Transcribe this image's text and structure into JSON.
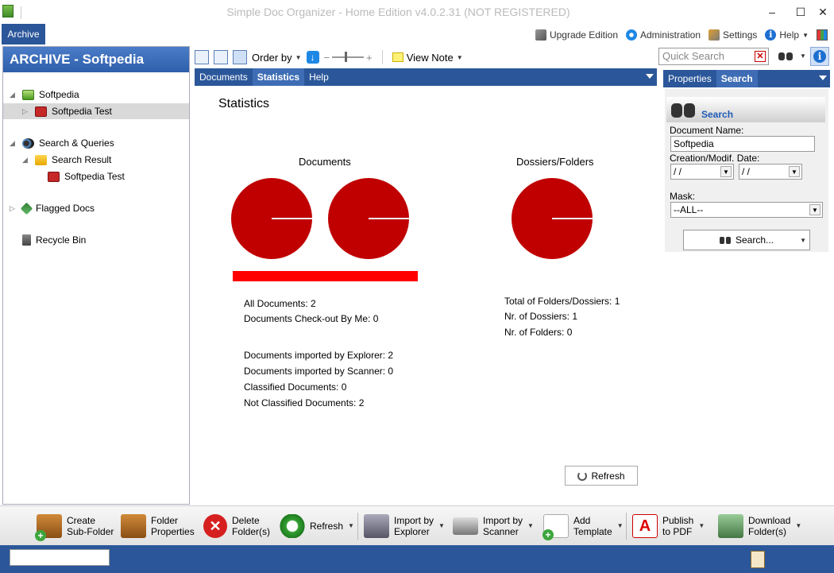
{
  "window": {
    "title": "Simple Doc Organizer - Home Edition v4.0.2.31 (NOT REGISTERED)",
    "minimize": "–",
    "maximize": "☐",
    "close": "✕"
  },
  "menu": {
    "archive_tab": "Archive",
    "links": [
      {
        "label": "Upgrade Edition",
        "icon": "upgrade-icon"
      },
      {
        "label": "Administration",
        "icon": "admin-icon"
      },
      {
        "label": "Settings",
        "icon": "settings-icon"
      },
      {
        "label": "Help",
        "icon": "help-icon"
      }
    ]
  },
  "left_panel": {
    "header": "ARCHIVE - Softpedia",
    "tree": [
      {
        "label": "Softpedia",
        "icon": "archive-icon"
      },
      {
        "label": "Softpedia Test",
        "icon": "case-icon"
      },
      {
        "label": "Search & Queries",
        "icon": "binoculars-icon"
      },
      {
        "label": "Search Result",
        "icon": "folder-icon"
      },
      {
        "label": "Softpedia Test",
        "icon": "case-icon"
      },
      {
        "label": "Flagged Docs",
        "icon": "flag-icon"
      },
      {
        "label": "Recycle Bin",
        "icon": "recycle-bin-icon"
      }
    ]
  },
  "toolbar": {
    "order_by": "Order by",
    "view_note": "View Note",
    "quick_search_placeholder": "Quick Search"
  },
  "tabs": {
    "center": [
      "Documents",
      "Statistics",
      "Help"
    ],
    "right": [
      "Properties",
      "Search"
    ]
  },
  "statistics": {
    "title": "Statistics",
    "documents_title": "Documents",
    "folders_title": "Dossiers/Folders",
    "doc_lines": [
      "All Documents: 2",
      "Documents Check-out By Me: 0"
    ],
    "doc_lines2": [
      "Documents imported by Explorer: 2",
      "Documents imported by Scanner: 0",
      "Classified Documents: 0",
      "Not Classified Documents: 2"
    ],
    "folder_lines": [
      "Total of Folders/Dossiers: 1",
      "Nr. of Dossiers: 1",
      "Nr. of Folders: 0"
    ],
    "refresh": "Refresh"
  },
  "search_panel": {
    "heading": "Search",
    "doc_name_label": "Document Name:",
    "doc_name_value": "Softpedia",
    "date_label": "Creation/Modif. Date:",
    "date_from": " /  /",
    "date_to": " /  /",
    "mask_label": "Mask:",
    "mask_value": "--ALL--",
    "search_button": "Search..."
  },
  "bottom_toolbar": [
    {
      "line1": "Create",
      "line2": "Sub-Folder"
    },
    {
      "line1": "Folder",
      "line2": "Properties"
    },
    {
      "line1": "Delete",
      "line2": "Folder(s)"
    },
    {
      "line1": "Refresh",
      "line2": ""
    },
    {
      "line1": "Import by",
      "line2": "Explorer"
    },
    {
      "line1": "Import by",
      "line2": "Scanner"
    },
    {
      "line1": "Add",
      "line2": "Template"
    },
    {
      "line1": "Publish",
      "line2": "to PDF"
    },
    {
      "line1": "Download",
      "line2": "Folder(s)"
    }
  ],
  "colors": {
    "accent": "#2b579a",
    "pie": "#c00000",
    "bar": "#ff0000"
  }
}
